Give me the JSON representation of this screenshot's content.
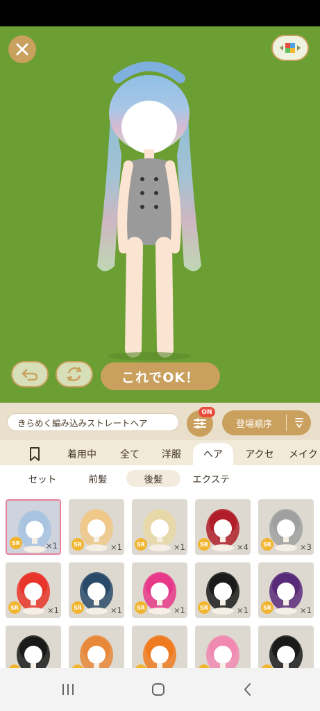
{
  "stage": {
    "background": "#6b9e33",
    "close_icon": "close-icon",
    "palette_icon": "color-palette-icon",
    "undo_icon": "undo-icon",
    "rotate_icon": "rotate-icon",
    "ok_label": "これでOK！"
  },
  "toolbar": {
    "item_name": "きらめく編み込みストレートヘア",
    "filter_badge": "ON",
    "sort_label": "登場順序"
  },
  "tabs": [
    "着用中",
    "全て",
    "洋服",
    "ヘア",
    "アクセ",
    "メイク"
  ],
  "active_tab": "ヘア",
  "subtabs": [
    "セット",
    "前髪",
    "後髪",
    "エクステ"
  ],
  "selected_subtab": "後髪",
  "items": [
    {
      "rarity": "SR",
      "qty": "×1",
      "hair": "#a9c4e0",
      "selected": true
    },
    {
      "rarity": "SR",
      "qty": "×1",
      "hair": "#f0c88a"
    },
    {
      "rarity": "SR",
      "qty": "×1",
      "hair": "#e8d8a8"
    },
    {
      "rarity": "SR",
      "qty": "×4",
      "hair": "#b01e2a"
    },
    {
      "rarity": "SR",
      "qty": "×3",
      "hair": "#a0a0a0"
    },
    {
      "rarity": "SR",
      "qty": "×1",
      "hair": "#e8342a"
    },
    {
      "rarity": "SR",
      "qty": "×1",
      "hair": "#2a4a6a"
    },
    {
      "rarity": "SR",
      "qty": "×1",
      "hair": "#e8388a"
    },
    {
      "rarity": "SR",
      "qty": "×1",
      "hair": "#1a1a1a"
    },
    {
      "rarity": "SR",
      "qty": "×1",
      "hair": "#5a2a7a"
    },
    {
      "rarity": "SR",
      "qty": "",
      "hair": "#1a1a1a"
    },
    {
      "rarity": "SR",
      "qty": "",
      "hair": "#e8883a"
    },
    {
      "rarity": "SR",
      "qty": "",
      "hair": "#f07a20"
    },
    {
      "rarity": "SR",
      "qty": "",
      "hair": "#f08ab0"
    },
    {
      "rarity": "SR",
      "qty": "",
      "hair": "#1a1a1a"
    }
  ],
  "navbar": {
    "recents_icon": "recent-apps-icon",
    "home_icon": "home-icon",
    "back_icon": "back-icon"
  }
}
